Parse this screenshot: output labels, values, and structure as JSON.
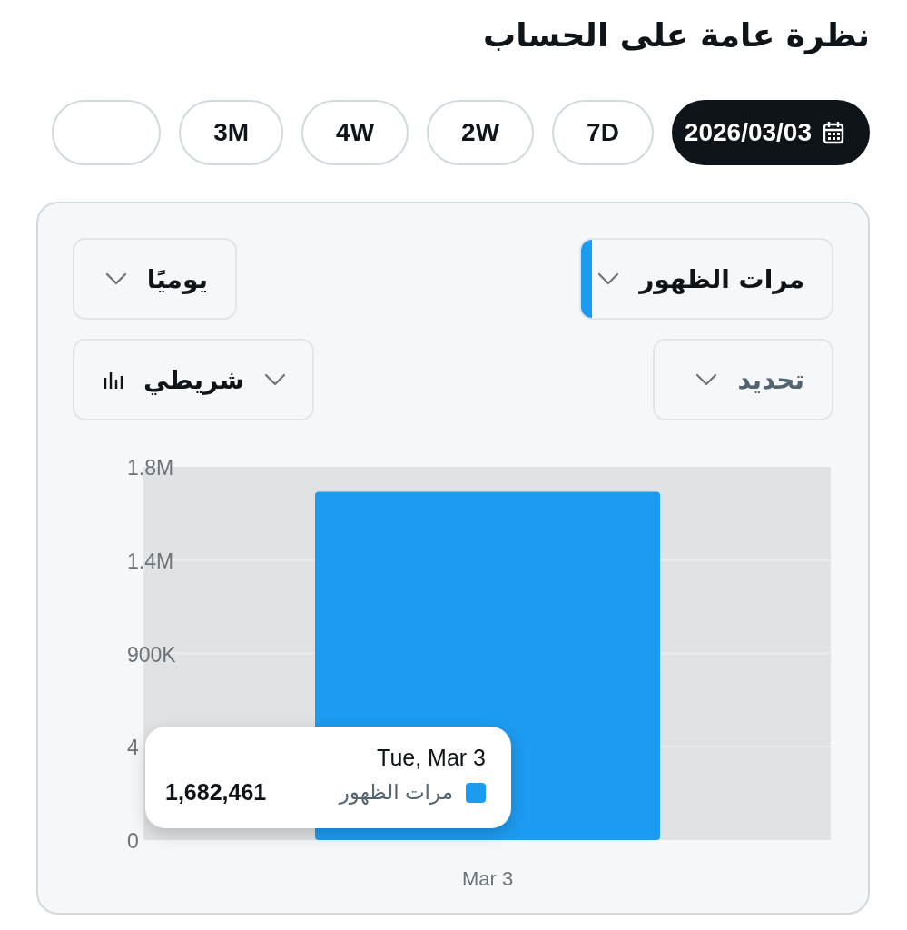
{
  "title": "نظرة عامة على الحساب",
  "ranges": [
    {
      "label": "2026/03/03",
      "kind": "date",
      "selected": true
    },
    {
      "label": "7D",
      "kind": "preset",
      "selected": false
    },
    {
      "label": "2W",
      "kind": "preset",
      "selected": false
    },
    {
      "label": "4W",
      "kind": "preset",
      "selected": false
    },
    {
      "label": "3M",
      "kind": "preset",
      "selected": false
    }
  ],
  "controls": [
    {
      "kind": "metric",
      "value": "مرات الظهور",
      "color": "#1d9bf0"
    },
    {
      "kind": "interval",
      "value": "يوميًا"
    },
    {
      "kind": "compare",
      "placeholder": "تحديد"
    },
    {
      "kind": "chart_type",
      "value": "شريطي"
    }
  ],
  "chart": {
    "chart_data": {
      "type": "bar",
      "categories": [
        "Mar 3"
      ],
      "ylim": [
        0,
        1800000
      ],
      "grid": true,
      "yticks": [
        0,
        {
          "value": 900000,
          "label": "900K"
        },
        {
          "value": 1350000,
          "label": "1.4M"
        },
        {
          "value": 1800000,
          "label": "1.8M"
        }
      ],
      "series": [
        {
          "name": "مرات الظهور",
          "color": "#1d9bf0",
          "values": [
            1680000
          ]
        }
      ]
    },
    "partly_hidden_tick_label": "4",
    "tooltip": {
      "title": "Tue, Mar 3",
      "value": "1,682,461"
    }
  }
}
